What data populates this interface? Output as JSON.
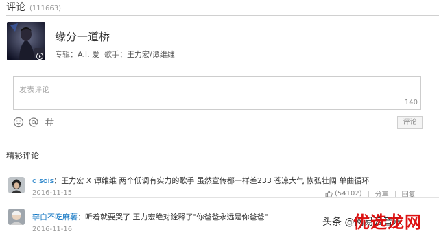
{
  "header": {
    "title": "评论",
    "count": "(111663)"
  },
  "song": {
    "title": "缘分一道桥",
    "album_label": "专辑：",
    "album_value": "A.I. 爱",
    "singer_label": "歌手：",
    "singer_value": "王力宏/谭维维"
  },
  "comment_input": {
    "placeholder": "发表评论",
    "char_limit": "140"
  },
  "toolbar": {
    "submit_label": "评论"
  },
  "section": {
    "title": "精彩评论"
  },
  "comments": [
    {
      "user": "disois",
      "text": "：王力宏 X 谭维维 两个低调有实力的歌手 虽然宣传都一样差233 苍凉大气 恢弘壮阔 单曲循环",
      "date": "2016-11-15",
      "likes": "(54102)",
      "share_label": "分享",
      "reply_label": "回复"
    },
    {
      "user": "李白不吃麻薯",
      "text": "：听着就要哭了 王力宏绝对诠释了\"你爸爸永远是你爸爸\"",
      "date": "2016-11-16"
    }
  ],
  "watermark": {
    "source": "头条",
    "handle": "@网易云音乐",
    "logo": "优选龙网"
  },
  "colors": {
    "link": "#0c73c2",
    "border": "#cdcdcd",
    "muted": "#999999"
  }
}
